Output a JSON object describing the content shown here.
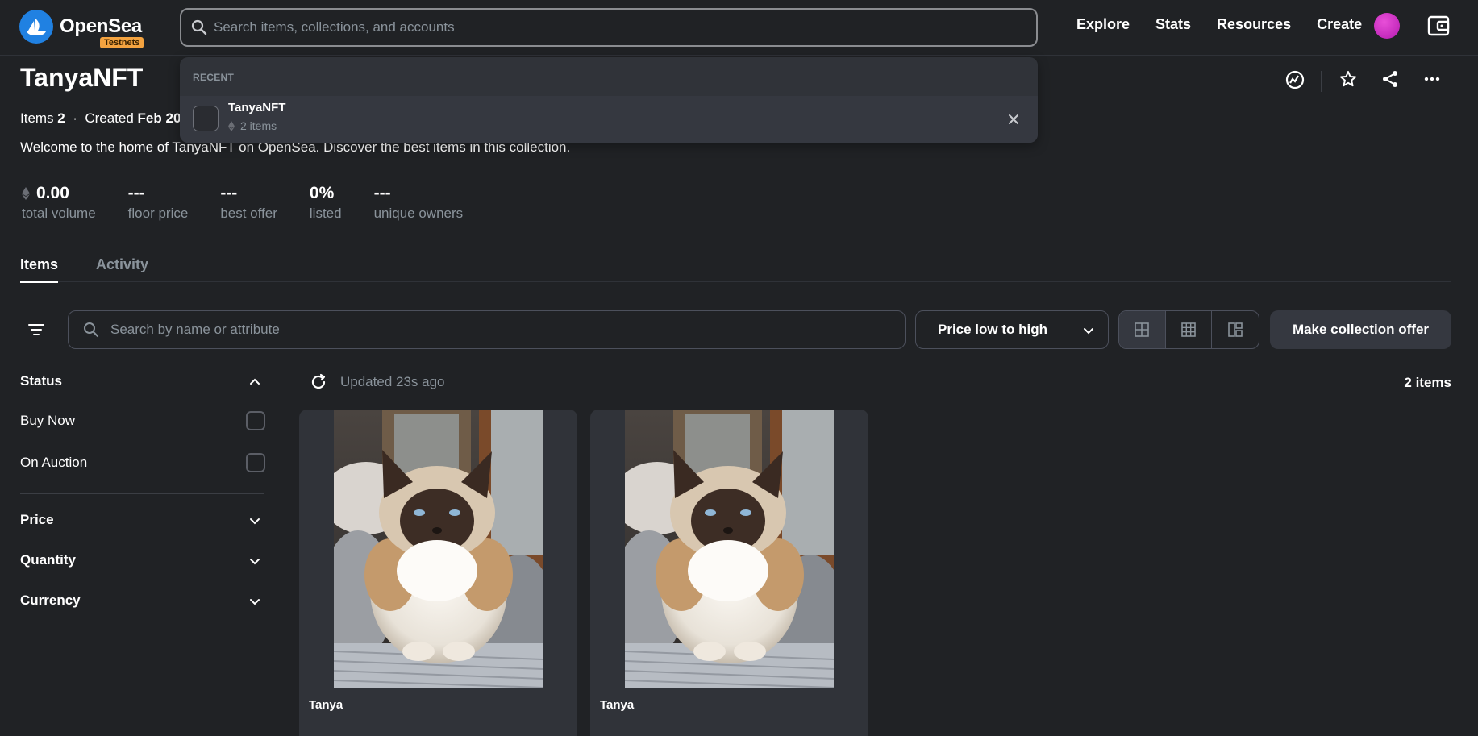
{
  "topnav": {
    "brand": "OpenSea",
    "badge": "Testnets",
    "search_placeholder": "Search items, collections, and accounts",
    "links": [
      "Explore",
      "Stats",
      "Resources",
      "Create"
    ]
  },
  "dropdown": {
    "header": "RECENT",
    "item_name": "TanyaNFT",
    "item_sub": "2 items"
  },
  "collection": {
    "title": "TanyaNFT",
    "items_label": "Items",
    "items_count": "2",
    "created_label": "Created",
    "created_value": "Feb 20",
    "description": "Welcome to the home of TanyaNFT on OpenSea. Discover the best items in this collection."
  },
  "stats": [
    {
      "value": "0.00",
      "label": "total volume"
    },
    {
      "value": "---",
      "label": "floor price"
    },
    {
      "value": "---",
      "label": "best offer"
    },
    {
      "value": "0%",
      "label": "listed"
    },
    {
      "value": "---",
      "label": "unique owners"
    }
  ],
  "tabs": [
    "Items",
    "Activity"
  ],
  "toolbar": {
    "search_placeholder": "Search by name or attribute",
    "sort_value": "Price low to high",
    "offer_button": "Make collection offer"
  },
  "sidebar": {
    "status": "Status",
    "buy_now": "Buy Now",
    "on_auction": "On Auction",
    "price": "Price",
    "quantity": "Quantity",
    "currency": "Currency"
  },
  "content": {
    "updated": "Updated 23s ago",
    "count": "2 items",
    "cards": [
      {
        "name": "Tanya"
      },
      {
        "name": "Tanya"
      }
    ]
  },
  "colors": {
    "background": "#202225",
    "surface": "#303339",
    "accent": "#2081e2",
    "badge": "#f4a340"
  }
}
